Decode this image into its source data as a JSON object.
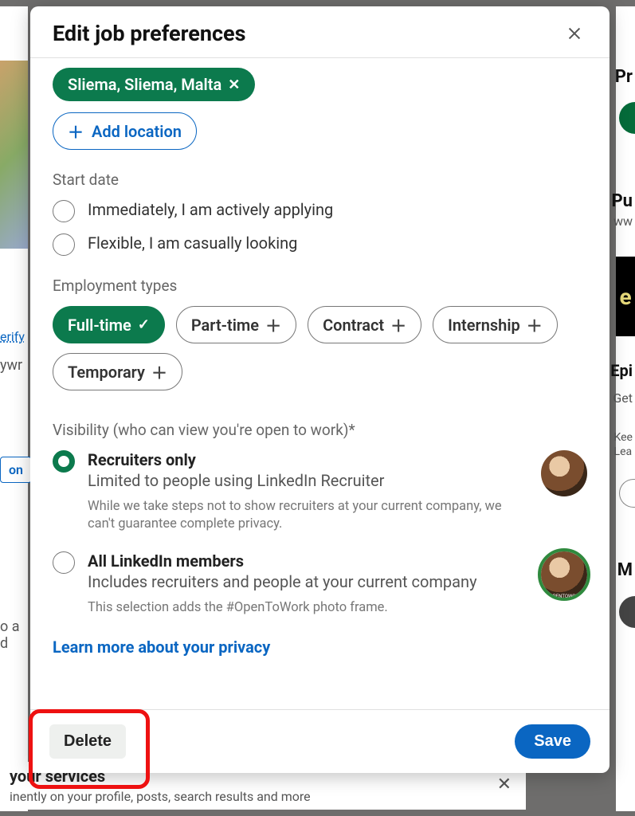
{
  "background": {
    "left": {
      "verify": "erify",
      "ywr": "ywr",
      "onBtn": "on",
      "oad": "o a d"
    },
    "right": {
      "pr": "Pr",
      "pu": "Pu",
      "ww": "ww",
      "blackLetter": "e",
      "epi": "Epi",
      "get": "Get",
      "kee": "Kee\nLea",
      "m": "M"
    },
    "services": {
      "title": "your services",
      "sub": "inently on your profile, posts, search results and more"
    }
  },
  "modal": {
    "title": "Edit job preferences",
    "locations": {
      "chips": [
        {
          "label": "Sliema, Sliema, Malta"
        }
      ],
      "addLabel": "Add location"
    },
    "startDate": {
      "label": "Start date",
      "options": [
        {
          "label": "Immediately, I am actively applying",
          "selected": false
        },
        {
          "label": "Flexible, I am casually looking",
          "selected": false
        }
      ]
    },
    "employment": {
      "label": "Employment types",
      "options": [
        {
          "label": "Full-time",
          "selected": true
        },
        {
          "label": "Part-time",
          "selected": false
        },
        {
          "label": "Contract",
          "selected": false
        },
        {
          "label": "Internship",
          "selected": false
        },
        {
          "label": "Temporary",
          "selected": false
        }
      ]
    },
    "visibility": {
      "label": "Visibility (who can view you're open to work)*",
      "options": [
        {
          "title": "Recruiters only",
          "desc": "Limited to people using LinkedIn Recruiter",
          "note": "While we take steps not to show recruiters at your current company, we can't guarantee complete privacy.",
          "selected": true,
          "frame": false
        },
        {
          "title": "All LinkedIn members",
          "desc": "Includes recruiters and people at your current company",
          "note": "This selection adds the #OpenToWork photo frame.",
          "selected": false,
          "frame": true
        }
      ],
      "privacyLink": "Learn more about your privacy"
    },
    "footer": {
      "delete": "Delete",
      "save": "Save"
    }
  }
}
